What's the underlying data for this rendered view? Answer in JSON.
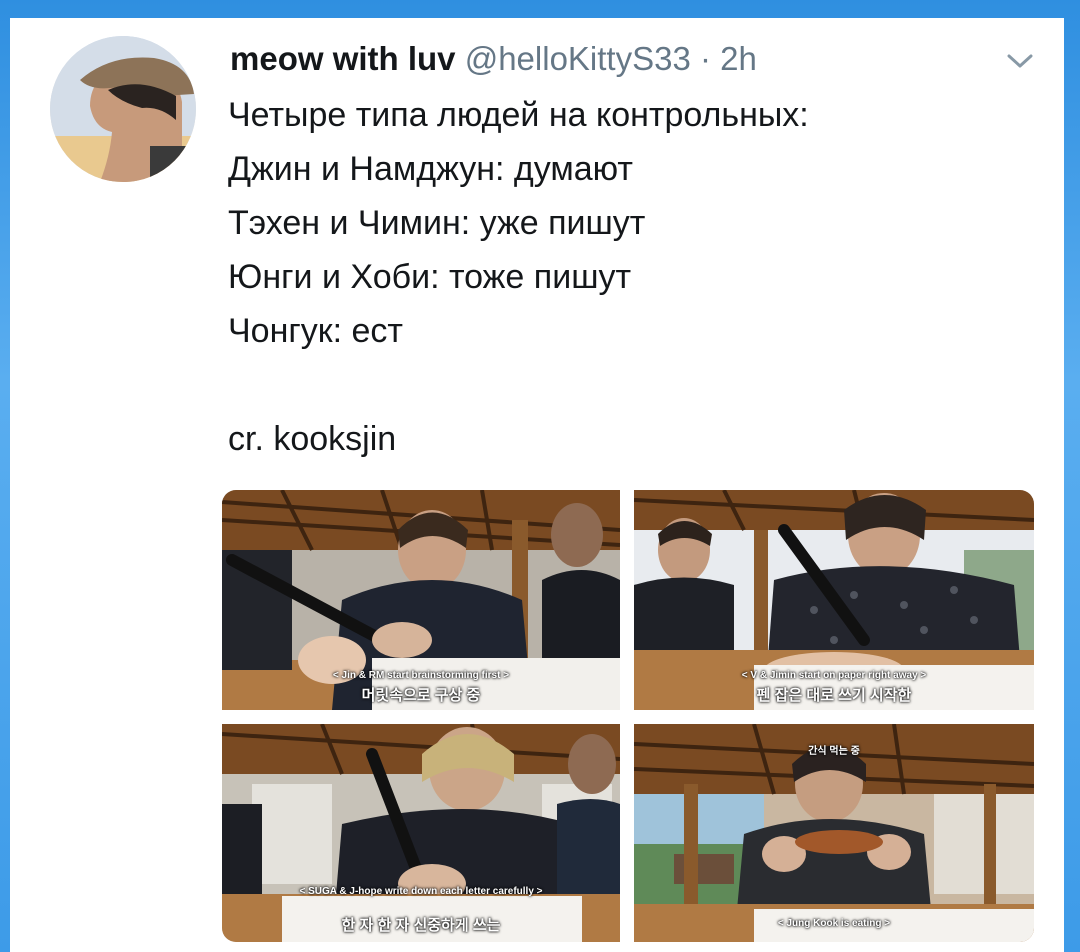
{
  "tweet": {
    "display_name": "meow with luv",
    "handle": "@helloKittyS33",
    "separator": "·",
    "time": "2h",
    "lines": [
      "Четыре типа людей на контрольных:",
      "Джин и Намджун: думают",
      "Тэхен и Чимин: уже пишут",
      "Юнги и Хоби: тоже пишут",
      "Чонгук: ест"
    ],
    "credit": "cr. kooksjin"
  },
  "icons": {
    "menu": "chevron-down-icon"
  },
  "colors": {
    "text": "#14171a",
    "secondary": "#657786",
    "background": "#3d9be8"
  },
  "photos": [
    {
      "subtitle_en": "< Jin & RM start brainstorming first >",
      "subtitle_ko": "머릿속으로 구상 중"
    },
    {
      "subtitle_en": "< V & Jimin start on paper right away >",
      "subtitle_ko": "펜 잡은 대로 쓰기 시작한"
    },
    {
      "subtitle_en": "< SUGA & J-hope write down each letter carefully >",
      "subtitle_ko": "한 자 한 자 신중하게 쓰는"
    },
    {
      "subtitle_en": "< Jung Kook is eating >",
      "subtitle_ko": "간식 먹는 중"
    }
  ]
}
